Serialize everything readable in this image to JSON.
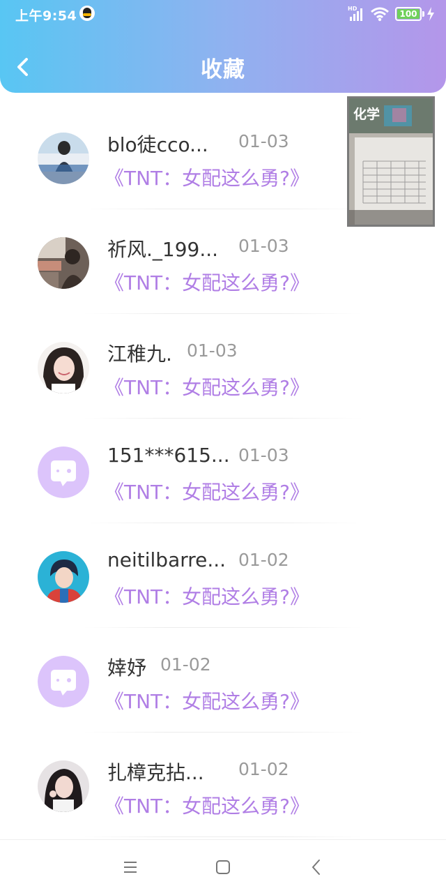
{
  "status_bar": {
    "time": "上午9:54",
    "network": "HD",
    "battery": "100"
  },
  "header": {
    "title": "收藏",
    "back_icon": "chevron-left-icon"
  },
  "favorites": [
    {
      "user": "blo徒cco...",
      "date": "01-03",
      "book": "《TNT：女配这么勇?》",
      "avatar": "photo-girl"
    },
    {
      "user": "祈风._199...",
      "date": "01-03",
      "book": "《TNT：女配这么勇?》",
      "avatar": "photo-room"
    },
    {
      "user": "江稚九.",
      "date": "01-03",
      "book": "《TNT：女配这么勇?》",
      "avatar": "photo-girl-smile"
    },
    {
      "user": "151***615...",
      "date": "01-03",
      "book": "《TNT：女配这么勇?》",
      "avatar": "default-chat-icon"
    },
    {
      "user": "neitilbarre...",
      "date": "01-02",
      "book": "《TNT：女配这么勇?》",
      "avatar": "photo-anime-boy"
    },
    {
      "user": "婞妤",
      "date": "01-02",
      "book": "《TNT：女配这么勇?》",
      "avatar": "default-chat-icon"
    },
    {
      "user": "扎樟克拈...",
      "date": "01-02",
      "book": "《TNT：女配这么勇?》",
      "avatar": "photo-girl-dark"
    }
  ],
  "pip_overlay": {
    "label": "化学"
  },
  "nav_bar": {
    "menu_icon": "menu-icon",
    "home_icon": "home-square-icon",
    "back_icon": "back-triangle-icon"
  },
  "colors": {
    "header_start": "#58c6f3",
    "header_end": "#b496ea",
    "book_title": "#b07ee5",
    "default_avatar": "#dcc4fb"
  }
}
